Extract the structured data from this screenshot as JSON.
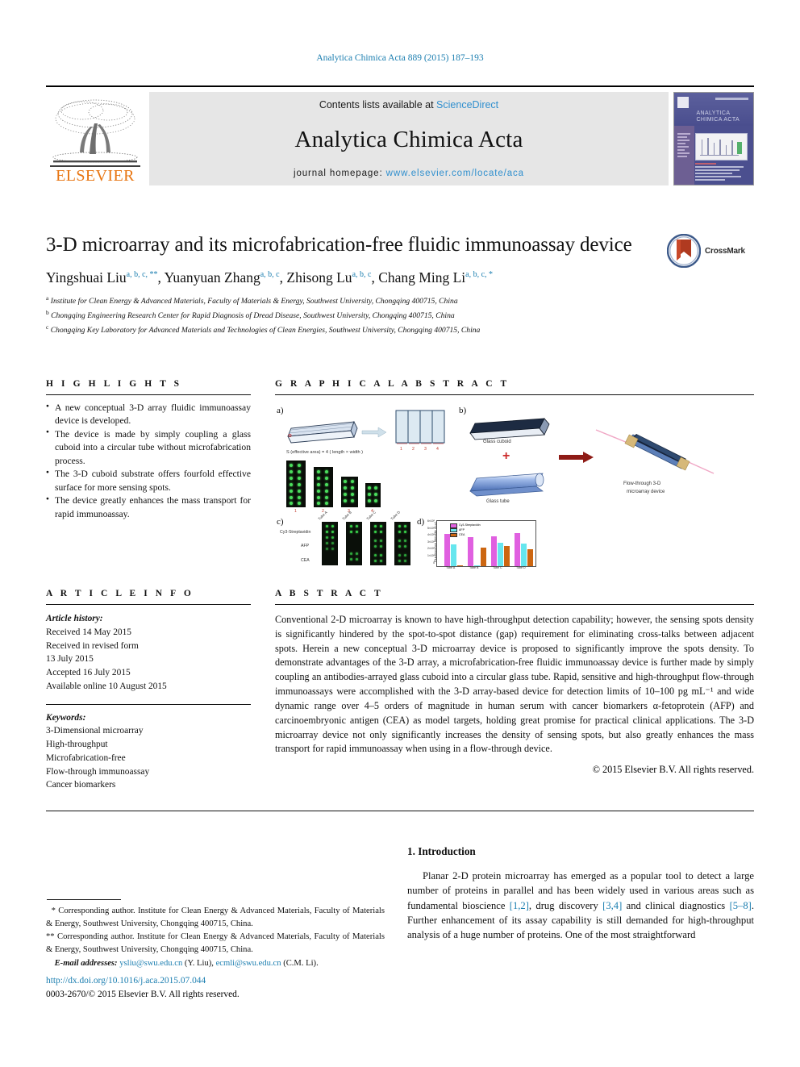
{
  "running_head": "Analytica Chimica Acta 889 (2015) 187–193",
  "masthead": {
    "contents_prefix": "Contents lists available at",
    "sciencedirect": "ScienceDirect",
    "journal_name": "Analytica Chimica Acta",
    "homepage_prefix": "journal homepage:",
    "homepage_url": "www.elsevier.com/locate/aca",
    "publisher": "ELSEVIER",
    "cover_title_line1": "ANALYTICA",
    "cover_title_line2": "CHIMICA ACTA"
  },
  "article": {
    "title": "3-D microarray and its microfabrication-free fluidic immunoassay device",
    "crossmark_label": "CrossMark",
    "authors": [
      {
        "name": "Yingshuai Liu",
        "marks": "a, b, c, **"
      },
      {
        "name": "Yuanyuan Zhang",
        "marks": "a, b, c"
      },
      {
        "name": "Zhisong Lu",
        "marks": "a, b, c"
      },
      {
        "name": "Chang Ming Li",
        "marks": "a, b, c, *"
      }
    ],
    "affiliations": [
      {
        "mark": "a",
        "text": "Institute for Clean Energy & Advanced Materials, Faculty of Materials & Energy, Southwest University, Chongqing 400715, China"
      },
      {
        "mark": "b",
        "text": "Chongqing Engineering Research Center for Rapid Diagnosis of Dread Disease, Southwest University, Chongqing 400715, China"
      },
      {
        "mark": "c",
        "text": "Chongqing Key Laboratory for Advanced Materials and Technologies of Clean Energies, Southwest University, Chongqing 400715, China"
      }
    ]
  },
  "highlights": {
    "heading": "H I G H L I G H T S",
    "items": [
      "A new conceptual 3-D array fluidic immunoassay device is developed.",
      "The device is made by simply coupling a glass cuboid into a circular tube without microfabrication process.",
      "The 3-D cuboid substrate offers fourfold effective surface for more sensing spots.",
      "The device greatly enhances the mass transport for rapid immunoassay."
    ]
  },
  "graphical_abstract": {
    "heading": "G R A P H I C A L   A B S T R A C T",
    "panels": {
      "a": "a)",
      "b": "b)",
      "c": "c)",
      "d": "d)"
    },
    "panel_a": {
      "formula": "S (effective area) = 4 ( length × width )",
      "column_numbers": [
        "1",
        "2",
        "3",
        "4"
      ],
      "array_numbers": [
        "1",
        "2",
        "3",
        "4"
      ]
    },
    "panel_b": {
      "cuboid_label": "Glass cuboid",
      "tube_label": "Glass tube",
      "plus": "+",
      "result_line1": "Flow-through 3-D",
      "result_line2": "microarray device"
    },
    "panel_c": {
      "row_labels": [
        "Cy3-Streptavidin",
        "AFP",
        "CEA"
      ],
      "column_labels": [
        "Tube A",
        "Tube B",
        "Tube C",
        "Tube D"
      ]
    }
  },
  "chart_data": {
    "type": "bar",
    "title": "",
    "xlabel": "",
    "ylabel": "Fluorescence intensity (a.u.)",
    "categories": [
      "Tube A",
      "Tube B",
      "Tube C",
      "Tube D"
    ],
    "ytick_labels": [
      "0",
      "1×10⁵",
      "2×10⁵",
      "3×10⁵",
      "4×10⁵",
      "5×10⁵",
      "6×10⁵"
    ],
    "ylim": [
      0,
      600000
    ],
    "legend_position": "top-left",
    "grid": false,
    "series": [
      {
        "name": "Cy3-Streptavidin",
        "color": "#e060e0",
        "values": [
          430000,
          385000,
          400000,
          440000
        ]
      },
      {
        "name": "AFP",
        "color": "#66e6ee",
        "values": [
          285000,
          12000,
          315000,
          300000
        ]
      },
      {
        "name": "CEA",
        "color": "#cc6611",
        "values": [
          10000,
          245000,
          265000,
          230000
        ]
      }
    ]
  },
  "article_info": {
    "heading": "A R T I C L E   I N F O",
    "history_label": "Article history:",
    "history": [
      "Received 14 May 2015",
      "Received in revised form",
      "13 July 2015",
      "Accepted 16 July 2015",
      "Available online 10 August 2015"
    ],
    "keywords_label": "Keywords:",
    "keywords": [
      "3-Dimensional microarray",
      "High-throughput",
      "Microfabrication-free",
      "Flow-through immunoassay",
      "Cancer biomarkers"
    ]
  },
  "abstract": {
    "heading": "A B S T R A C T",
    "text": "Conventional 2-D microarray is known to have high-throughput detection capability; however, the sensing spots density is significantly hindered by the spot-to-spot distance (gap) requirement for eliminating cross-talks between adjacent spots. Herein a new conceptual 3-D microarray device is proposed to significantly improve the spots density. To demonstrate advantages of the 3-D array, a microfabrication-free fluidic immunoassay device is further made by simply coupling an antibodies-arrayed glass cuboid into a circular glass tube. Rapid, sensitive and high-throughput flow-through immunoassays were accomplished with the 3-D array-based device for detection limits of 10–100 pg mL⁻¹ and wide dynamic range over 4–5 orders of magnitude in human serum with cancer biomarkers α-fetoprotein (AFP) and carcinoembryonic antigen (CEA) as model targets, holding great promise for practical clinical applications. The 3-D microarray device not only significantly increases the density of sensing spots, but also greatly enhances the mass transport for rapid immunoassay when using in a flow-through device.",
    "copyright": "© 2015 Elsevier B.V. All rights reserved."
  },
  "footnotes": {
    "corr1_mark": "*",
    "corr1": "Corresponding author. Institute for Clean Energy & Advanced Materials, Faculty of Materials & Energy, Southwest University, Chongqing 400715, China.",
    "corr2_mark": "**",
    "corr2": "Corresponding author. Institute for Clean Energy & Advanced Materials, Faculty of Materials & Energy, Southwest University, Chongqing 400715, China.",
    "email_label": "E-mail addresses:",
    "email1": "ysliu@swu.edu.cn",
    "email1_owner": "(Y. Liu),",
    "email2": "ecmli@swu.edu.cn",
    "email2_owner": "(C.M. Li)."
  },
  "doi": {
    "url": "http://dx.doi.org/10.1016/j.aca.2015.07.044",
    "issn_line": "0003-2670/© 2015 Elsevier B.V. All rights reserved."
  },
  "introduction": {
    "heading": "1. Introduction",
    "paragraph_1": "Planar 2-D protein microarray has emerged as a popular tool to detect a large number of proteins in parallel and has been widely used in various areas such as fundamental bioscience",
    "ref_1": "[1,2]",
    "paragraph_1b": ", drug discovery",
    "ref_2": "[3,4]",
    "paragraph_1c": " and clinical diagnostics",
    "ref_3": "[5–8]",
    "paragraph_1d": ". Further enhancement of its assay capability is still demanded for high-throughput analysis of a huge number of proteins. One of the most straightforward"
  }
}
